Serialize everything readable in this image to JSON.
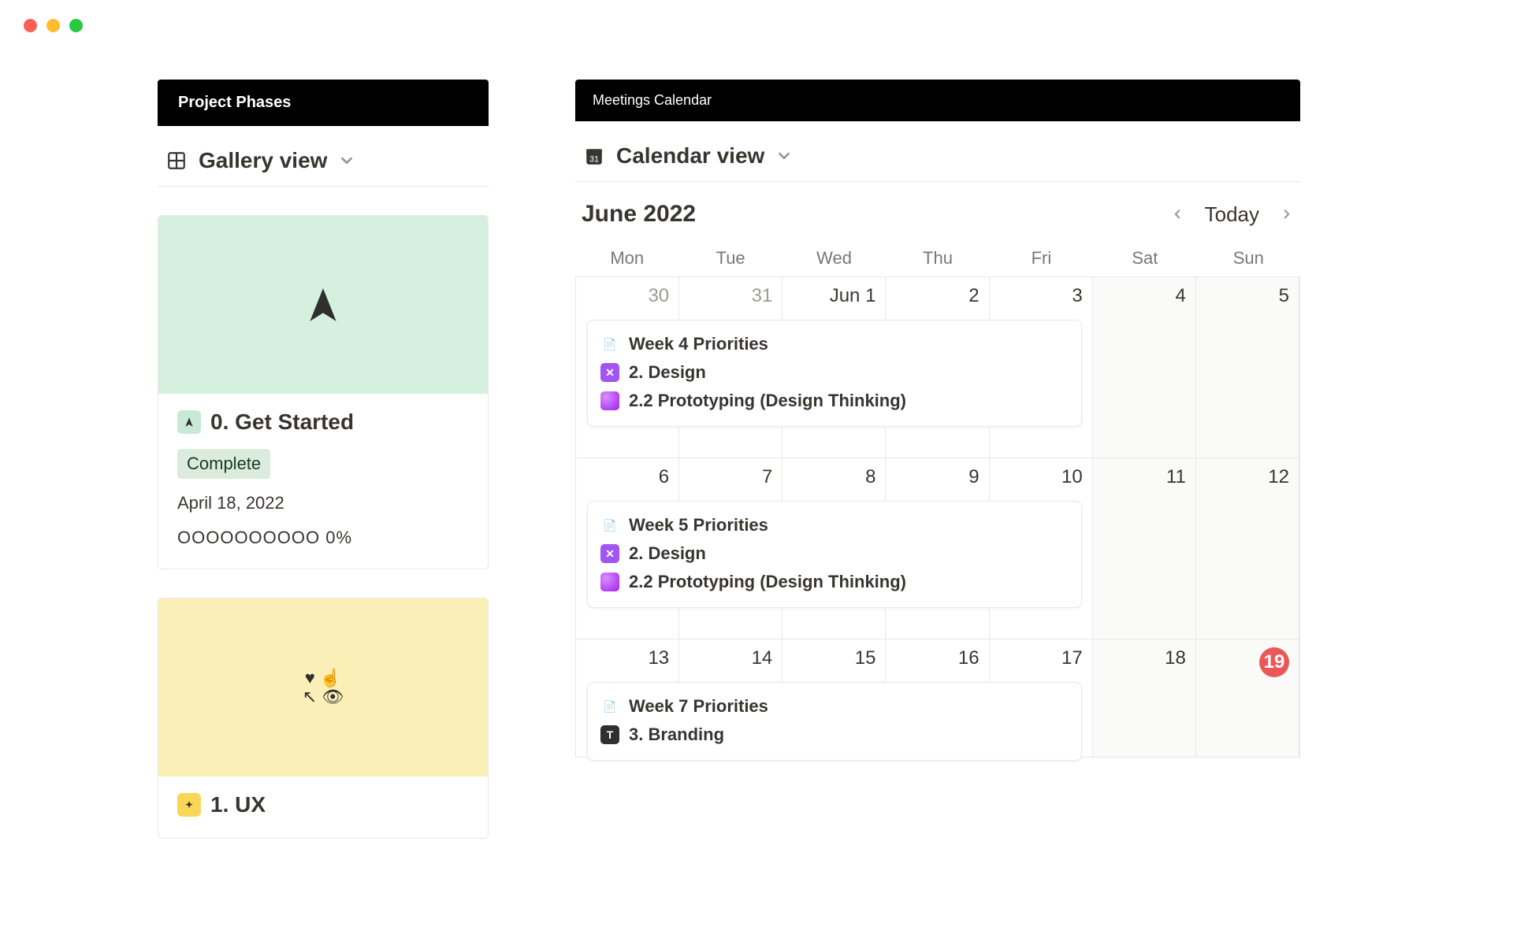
{
  "left_panel": {
    "title": "Project Phases",
    "view_label": "Gallery view",
    "cards": [
      {
        "title": "0. Get Started",
        "status": "Complete",
        "date": "April 18, 2022",
        "progress": "OOOOOOOOOO 0%"
      },
      {
        "title": "1. UX"
      }
    ]
  },
  "right_panel": {
    "title": "Meetings Calendar",
    "view_label": "Calendar view",
    "month_label": "June 2022",
    "today_label": "Today",
    "days": [
      "Mon",
      "Tue",
      "Wed",
      "Thu",
      "Fri",
      "Sat",
      "Sun"
    ],
    "rows": [
      {
        "cells": [
          "30",
          "31",
          "Jun 1",
          "2",
          "3",
          "4",
          "5"
        ],
        "muted": [
          0,
          1
        ],
        "event": {
          "lines": [
            {
              "icon": "doc",
              "text": "Week 4 Priorities"
            },
            {
              "icon": "purple-x",
              "text": "2. Design"
            },
            {
              "icon": "purple-ball",
              "text": "2.2 Prototyping (Design Thinking)"
            }
          ]
        }
      },
      {
        "cells": [
          "6",
          "7",
          "8",
          "9",
          "10",
          "11",
          "12"
        ],
        "event": {
          "lines": [
            {
              "icon": "doc",
              "text": "Week 5 Priorities"
            },
            {
              "icon": "purple-x",
              "text": "2. Design"
            },
            {
              "icon": "purple-ball",
              "text": "2.2 Prototyping (Design Thinking)"
            }
          ]
        }
      },
      {
        "cells": [
          "13",
          "14",
          "15",
          "16",
          "17",
          "18",
          "19"
        ],
        "today_index": 6,
        "event": {
          "lines": [
            {
              "icon": "doc",
              "text": "Week 7 Priorities"
            },
            {
              "icon": "dark",
              "text": "3. Branding"
            }
          ]
        }
      }
    ]
  }
}
